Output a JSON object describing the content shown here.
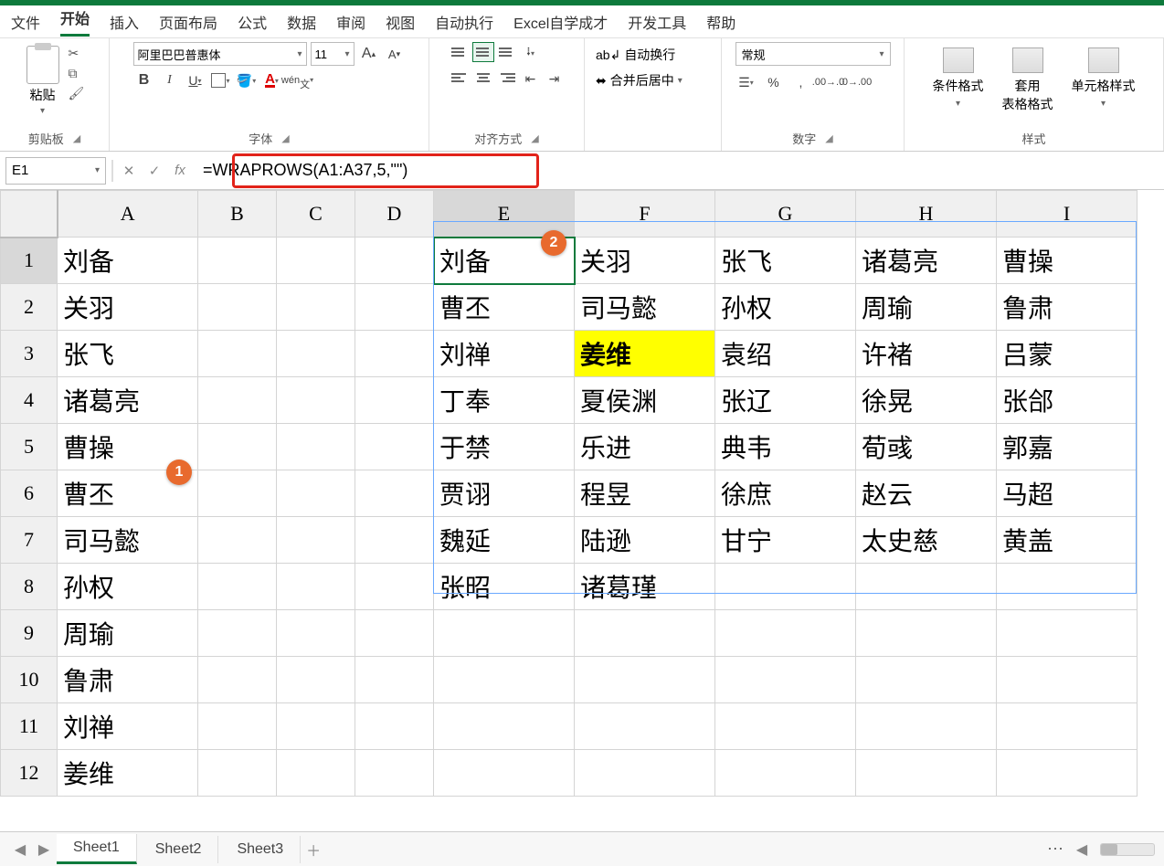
{
  "menu": {
    "file": "文件",
    "home": "开始",
    "insert": "插入",
    "layout": "页面布局",
    "formula": "公式",
    "data": "数据",
    "review": "审阅",
    "view": "视图",
    "auto": "自动执行",
    "excel": "Excel自学成才",
    "dev": "开发工具",
    "help": "帮助"
  },
  "ribbon": {
    "clipboard": {
      "paste": "粘贴",
      "label": "剪贴板"
    },
    "font": {
      "name": "阿里巴巴普惠体",
      "size": "11",
      "label": "字体",
      "pinyin": "wén"
    },
    "align": {
      "label": "对齐方式"
    },
    "wrap": {
      "wrap": "自动换行",
      "merge": "合并后居中"
    },
    "number": {
      "format": "常规",
      "label": "数字"
    },
    "styles": {
      "cond": "条件格式",
      "table": "套用\n表格格式",
      "cell": "单元格样式",
      "label": "样式"
    }
  },
  "formulabar": {
    "cell": "E1",
    "formula": "=WRAPROWS(A1:A37,5,\"\")"
  },
  "columns": [
    "A",
    "B",
    "C",
    "D",
    "E",
    "F",
    "G",
    "H",
    "I"
  ],
  "rows": [
    "1",
    "2",
    "3",
    "4",
    "5",
    "6",
    "7",
    "8",
    "9",
    "10",
    "11",
    "12"
  ],
  "colA": [
    "刘备",
    "关羽",
    "张飞",
    "诸葛亮",
    "曹操",
    "曹丕",
    "司马懿",
    "孙权",
    "周瑜",
    "鲁肃",
    "刘禅",
    "姜维"
  ],
  "wrapped": [
    [
      "刘备",
      "关羽",
      "张飞",
      "诸葛亮",
      "曹操"
    ],
    [
      "曹丕",
      "司马懿",
      "孙权",
      "周瑜",
      "鲁肃"
    ],
    [
      "刘禅",
      "姜维",
      "袁绍",
      "许褚",
      "吕蒙"
    ],
    [
      "丁奉",
      "夏侯渊",
      "张辽",
      "徐晃",
      "张郃"
    ],
    [
      "于禁",
      "乐进",
      "典韦",
      "荀彧",
      "郭嘉"
    ],
    [
      "贾诩",
      "程昱",
      "徐庶",
      "赵云",
      "马超"
    ],
    [
      "魏延",
      "陆逊",
      "甘宁",
      "太史慈",
      "黄盖"
    ],
    [
      "张昭",
      "诸葛瑾",
      "",
      "",
      ""
    ]
  ],
  "highlight": {
    "row": 2,
    "col": 1
  },
  "badges": {
    "b1": "1",
    "b2": "2"
  },
  "tabs": {
    "s1": "Sheet1",
    "s2": "Sheet2",
    "s3": "Sheet3"
  }
}
